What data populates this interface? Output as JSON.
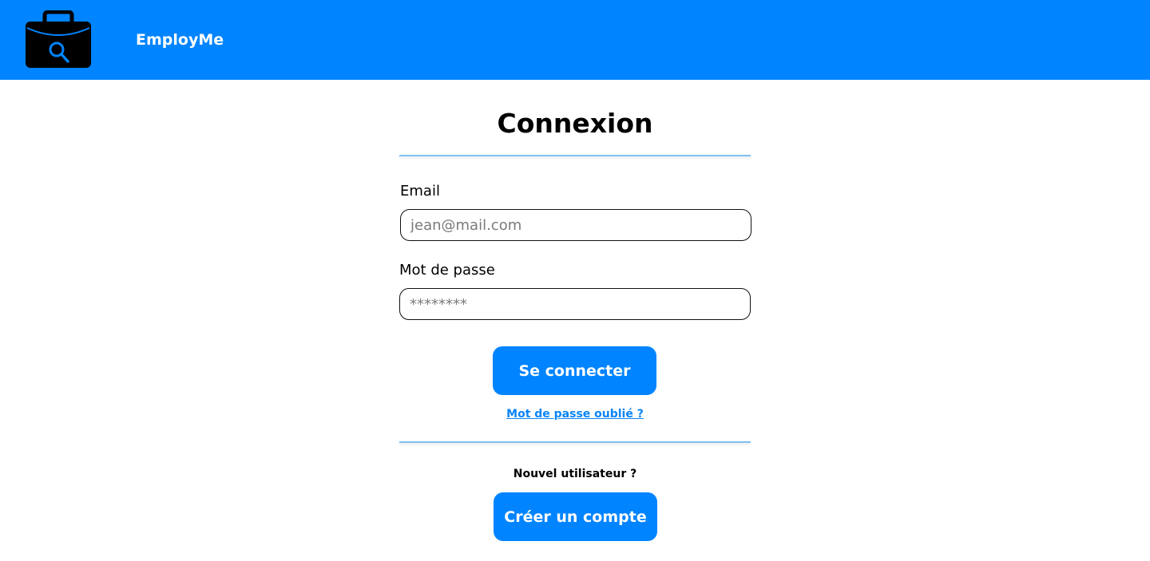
{
  "header": {
    "brand": "EmployMe",
    "logo_icon": "briefcase-search-icon",
    "background": "#0084ff"
  },
  "login": {
    "title": "Connexion",
    "email_label": "Email",
    "email_placeholder": "jean@mail.com",
    "password_label": "Mot de passe",
    "password_placeholder": "********",
    "submit_label": "Se connecter",
    "forgot_link": "Mot de passe oublié ?"
  },
  "signup": {
    "prompt": "Nouvel utilisateur ?",
    "create_label": "Créer un compte"
  },
  "colors": {
    "accent": "#0084ff",
    "divider": "#7fc0f5",
    "link": "#0a84f5"
  }
}
